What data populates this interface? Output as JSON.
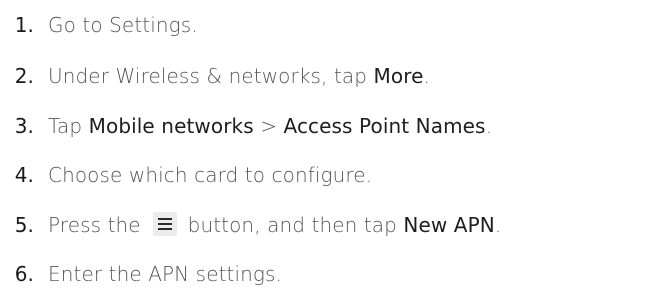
{
  "steps": [
    {
      "number": "1.",
      "text_a": "Go to Settings."
    },
    {
      "number": "2.",
      "text_a": "Under Wireless & networks, tap ",
      "term_a": "More",
      "text_b": "."
    },
    {
      "number": "3.",
      "text_a": "Tap ",
      "term_a": "Mobile networks",
      "text_b": " > ",
      "term_b": "Access Point Names",
      "text_c": "."
    },
    {
      "number": "4.",
      "text_a": "Choose which card to configure."
    },
    {
      "number": "5.",
      "text_a": "Press the ",
      "icon": "menu-icon",
      "text_b": " button, and then tap ",
      "term_a": "New APN",
      "text_c": "."
    },
    {
      "number": "6.",
      "text_a": "Enter the APN settings."
    }
  ]
}
